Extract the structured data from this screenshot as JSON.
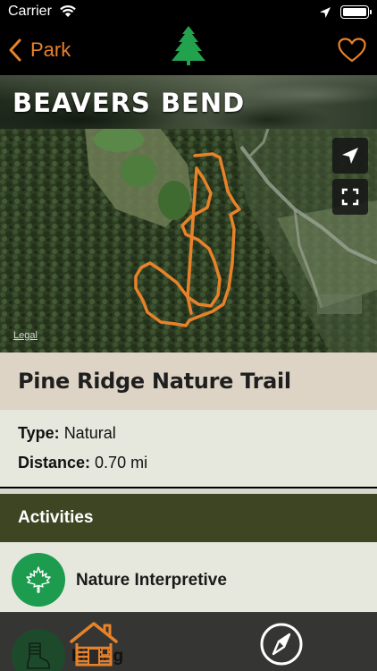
{
  "status_bar": {
    "carrier": "Carrier",
    "time": "",
    "icons": [
      "wifi-icon",
      "location-arrow-icon",
      "battery-icon"
    ]
  },
  "nav": {
    "back_label": "Park",
    "logo": "pine-tree-icon",
    "favorite_icon": "heart-icon",
    "accent_color": "#e8822a"
  },
  "header": {
    "park_name": "BEAVERS BEND"
  },
  "map": {
    "legal_label": "Legal",
    "controls": [
      "location-arrow-icon",
      "fullscreen-icon"
    ],
    "trail_color": "#e8822a"
  },
  "trail": {
    "name": "Pine Ridge Nature Trail",
    "type_label": "Type:",
    "type_value": "Natural",
    "distance_label": "Distance:",
    "distance_value": "0.70 mi"
  },
  "activities": {
    "title": "Activities",
    "items": [
      {
        "label": "Nature Interpretive",
        "icon": "maple-leaf-icon",
        "color": "#1d9b4e"
      },
      {
        "label": "Hiking",
        "icon": "hiker-boot-icon",
        "color": "#1d9b4e"
      }
    ]
  },
  "tab_bar": {
    "tabs": [
      {
        "icon": "cabin-icon"
      },
      {
        "icon": "compass-icon"
      }
    ]
  }
}
